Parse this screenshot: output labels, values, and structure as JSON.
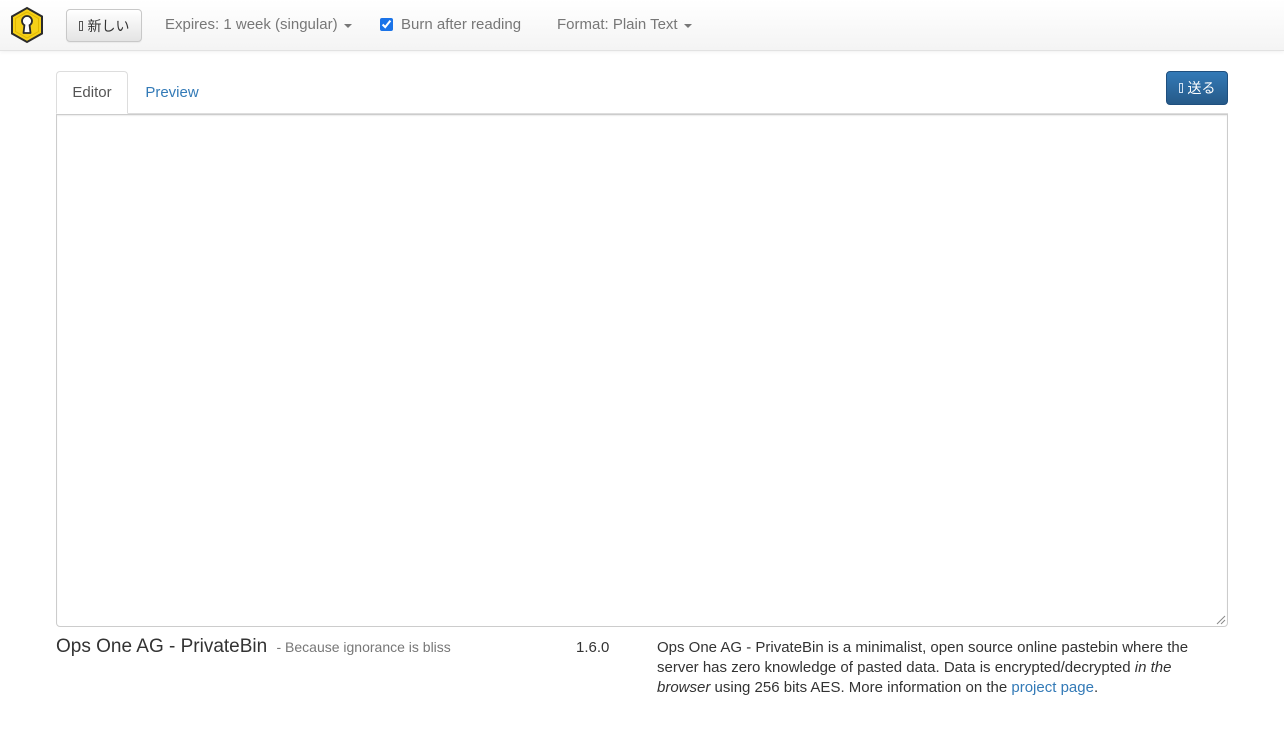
{
  "navbar": {
    "logo_icon": "keyhole-shield-icon",
    "new_button_label": "新しい",
    "expires_label": "Expires: 1 week (singular)",
    "burn_label": "Burn after reading",
    "burn_checked": true,
    "format_label": "Format: Plain Text"
  },
  "tabs": {
    "editor": "Editor",
    "preview": "Preview",
    "active": "editor"
  },
  "send_button_label": "送る",
  "editor": {
    "value": ""
  },
  "footer": {
    "brand": "Ops One AG - PrivateBin",
    "tagline": "- Because ignorance is bliss",
    "version": "1.6.0",
    "about_part1": "Ops One AG - PrivateBin is a minimalist, open source online pastebin where the server has zero knowledge of pasted data. Data is encrypted/decrypted ",
    "about_emphasis": "in the browser",
    "about_part2": " using 256 bits AES. More information on the ",
    "about_link": "project page",
    "about_end": "."
  },
  "colors": {
    "primary": "#337ab7",
    "logo_yellow": "#f5d018",
    "muted_text": "#777777"
  }
}
